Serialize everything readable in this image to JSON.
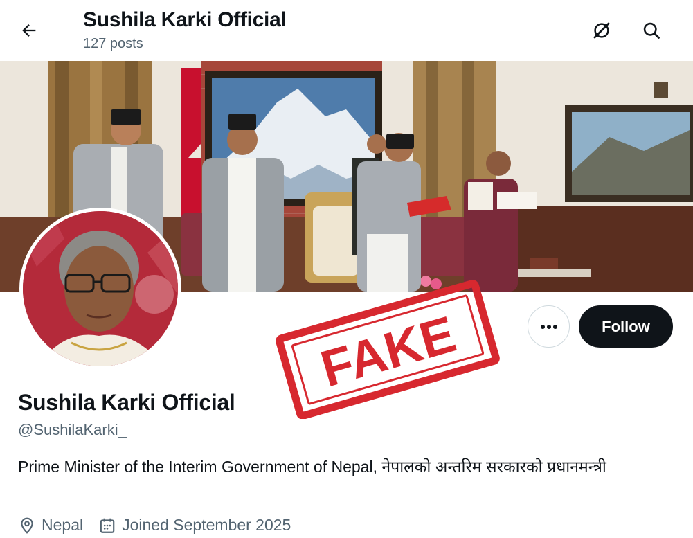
{
  "header": {
    "title": "Sushila Karki Official",
    "post_count": "127 posts",
    "back_icon": "arrow-left-icon",
    "grok_icon": "grok-icon",
    "search_icon": "search-icon"
  },
  "profile": {
    "display_name": "Sushila Karki Official",
    "handle": "@SushilaKarki_",
    "bio": "Prime Minister of the Interim Government of Nepal, नेपालको अन्तरिम सरकारको प्रधानमन्त्री",
    "location": "Nepal",
    "joined": "Joined September 2025"
  },
  "actions": {
    "more_icon": "more-dots-icon",
    "follow_label": "Follow"
  },
  "overlay": {
    "stamp_text": "FAKE",
    "stamp_color": "#d7282f"
  },
  "colors": {
    "text_primary": "#0f1419",
    "text_secondary": "#536471",
    "follow_bg": "#0f1419",
    "nepal_red": "#c8102e"
  }
}
